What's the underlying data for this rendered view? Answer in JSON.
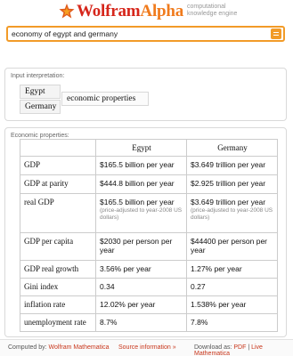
{
  "brand": {
    "name_part1": "Wolfram",
    "name_part2": "Alpha",
    "tagline_line1": "computational",
    "tagline_line2": "knowledge engine"
  },
  "search": {
    "value": "economy of egypt and germany"
  },
  "interpretation_pod": {
    "title": "Input interpretation:",
    "entities": [
      "Egypt",
      "Germany"
    ],
    "property": "economic properties"
  },
  "economic_pod": {
    "title": "Economic properties:",
    "columns": [
      "Egypt",
      "Germany"
    ],
    "rows": [
      {
        "label": "GDP",
        "egypt": "$165.5 billion per year",
        "germany": "$3.649 trillion per year"
      },
      {
        "label": "GDP at parity",
        "egypt": "$444.8 billion per year",
        "germany": "$2.925 trillion per year"
      },
      {
        "label": "real GDP",
        "egypt": "$165.5 billion per year",
        "egypt_note": "(price-adjusted to year-2008 US dollars)",
        "germany": "$3.649 trillion per year",
        "germany_note": "(price-adjusted to year-2008 US dollars)"
      },
      {
        "label": "GDP per capita",
        "egypt": "$2030 per person per year",
        "germany": "$44400 per person per year"
      },
      {
        "label": "GDP real growth",
        "egypt": "3.56% per year",
        "germany": "1.27% per year"
      },
      {
        "label": "Gini index",
        "egypt": "0.34",
        "germany": "0.27"
      },
      {
        "label": "inflation rate",
        "egypt": "12.02% per year",
        "germany": "1.538% per year"
      },
      {
        "label": "unemployment rate",
        "egypt": "8.7%",
        "germany": "7.8%"
      }
    ]
  },
  "footer": {
    "computed_by": "Computed by:",
    "mathematica": "Wolfram Mathematica",
    "source": "Source information »",
    "download_as": "Download as:",
    "pdf": "PDF",
    "separator": "|",
    "live": "Live Mathematica"
  },
  "colors": {
    "brand_red": "#d6261b",
    "brand_orange": "#f07b1d",
    "search_border": "#f29b28",
    "link": "#c8361b"
  },
  "icons": {
    "logo": "wolfram-star-icon",
    "search_submit": "equals-icon"
  }
}
